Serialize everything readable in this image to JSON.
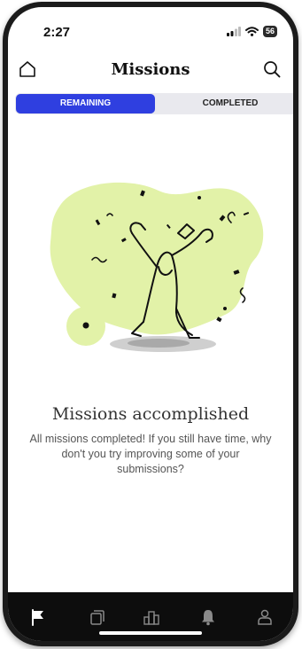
{
  "status_bar": {
    "time": "2:27",
    "battery_level": "56",
    "icons": [
      "signal-icon",
      "wifi-icon",
      "battery-icon"
    ]
  },
  "header": {
    "title": "Missions",
    "left_icon": "home-icon",
    "right_icon": "search-icon"
  },
  "tabs": [
    {
      "label": "REMAINING",
      "active": true
    },
    {
      "label": "COMPLETED",
      "active": false
    }
  ],
  "empty_state": {
    "illustration": "celebrating-figure-illustration",
    "headline": "Missions accomplished",
    "message": "All missions completed! If you still have time, why don't you try improving some of your submissions?"
  },
  "bottom_nav": {
    "items": [
      {
        "icon": "flag-icon",
        "active": true
      },
      {
        "icon": "cards-icon",
        "active": false
      },
      {
        "icon": "leaderboard-icon",
        "active": false
      },
      {
        "icon": "bell-icon",
        "active": false
      },
      {
        "icon": "profile-icon",
        "active": false
      }
    ]
  },
  "colors": {
    "accent": "#2f3fe0",
    "illustration_blob": "#e2f2a8",
    "nav_background": "#0d0d0d"
  }
}
